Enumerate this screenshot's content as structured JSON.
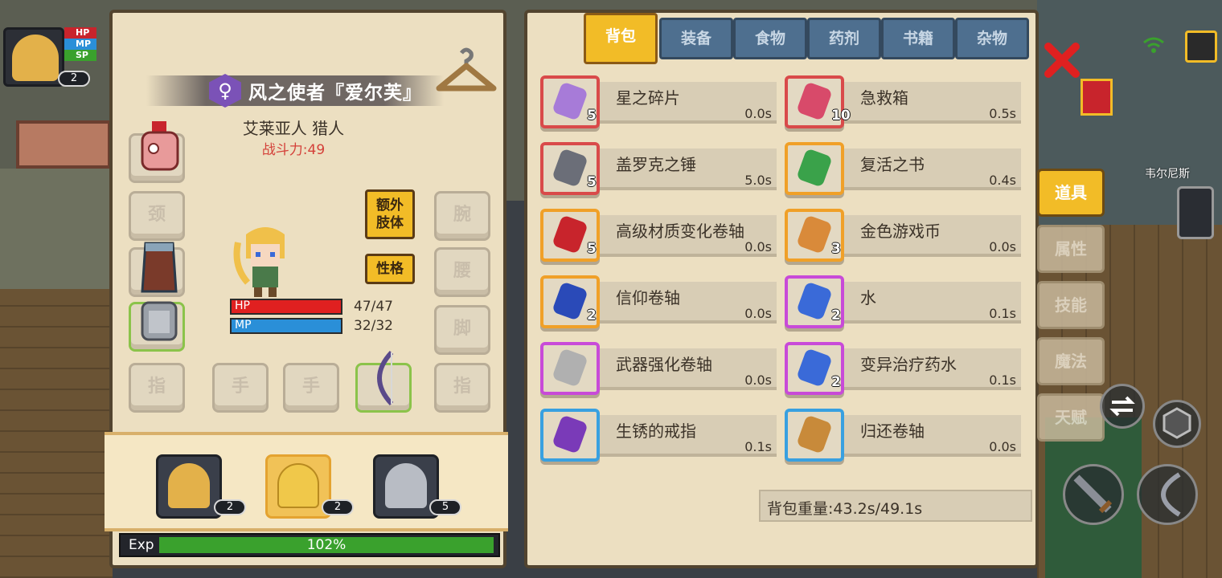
{
  "hud": {
    "stat_labels": [
      "HP",
      "MP",
      "SP"
    ],
    "portrait_level": "2",
    "npc_name": "韦尔尼斯"
  },
  "character": {
    "name": "风之使者『爱尔芙』",
    "gender_symbol": "♀",
    "race_class": "艾莱亚人 猎人",
    "power": "战斗力:49",
    "slots": {
      "neck": "颈",
      "wrist": "腕",
      "waist": "腰",
      "foot": "脚",
      "finger_left": "指",
      "hand_left": "手",
      "hand_right": "手",
      "finger_right": "指"
    },
    "extra_limb_button": "额外肢体",
    "personality_button": "性格",
    "hp_label": "HP",
    "hp_value": "47/47",
    "mp_label": "MP",
    "mp_value": "32/32",
    "hp_fraction": 1,
    "mp_fraction": 1
  },
  "party": [
    {
      "level": "2"
    },
    {
      "level": "2"
    },
    {
      "level": "5"
    }
  ],
  "exp": {
    "label": "Exp",
    "percent_text": "102%",
    "fill_fraction": 1
  },
  "inventory": {
    "tabs": [
      "背包",
      "装备",
      "食物",
      "药剂",
      "书籍",
      "杂物"
    ],
    "active_tab": "背包",
    "items": [
      {
        "name": "星之碎片",
        "qty": "5",
        "weight": "0.0s",
        "border": "#d94a4a",
        "icon_color": "#a77bd8"
      },
      {
        "name": "急救箱",
        "qty": "10",
        "weight": "0.5s",
        "border": "#d94a4a",
        "icon_color": "#d84a6a"
      },
      {
        "name": "盖罗克之锤",
        "qty": "5",
        "weight": "5.0s",
        "border": "#d94a4a",
        "icon_color": "#6b6e78"
      },
      {
        "name": "复活之书",
        "qty": "",
        "weight": "0.4s",
        "border": "#f0a028",
        "icon_color": "#3aa24a"
      },
      {
        "name": "高级材质变化卷轴",
        "qty": "5",
        "weight": "0.0s",
        "border": "#f0a028",
        "icon_color": "#c8242c"
      },
      {
        "name": "金色游戏币",
        "qty": "3",
        "weight": "0.0s",
        "border": "#f0a028",
        "icon_color": "#d98a3a"
      },
      {
        "name": "信仰卷轴",
        "qty": "2",
        "weight": "0.0s",
        "border": "#f0a028",
        "icon_color": "#2a4ab8"
      },
      {
        "name": "水",
        "qty": "2",
        "weight": "0.1s",
        "border": "#c84ad8",
        "icon_color": "#3a6ad8"
      },
      {
        "name": "武器强化卷轴",
        "qty": "",
        "weight": "0.0s",
        "border": "#c84ad8",
        "icon_color": "#b0b0b0"
      },
      {
        "name": "变异治疗药水",
        "qty": "2",
        "weight": "0.1s",
        "border": "#c84ad8",
        "icon_color": "#3a6ad8"
      },
      {
        "name": "生锈的戒指",
        "qty": "",
        "weight": "0.1s",
        "border": "#38a0e0",
        "icon_color": "#7a3ab8"
      },
      {
        "name": "归还卷轴",
        "qty": "",
        "weight": "0.0s",
        "border": "#38a0e0",
        "icon_color": "#c88a3a"
      }
    ],
    "weight_summary": "背包重量:43.2s/49.1s"
  },
  "side_menu": [
    "道具",
    "属性",
    "技能",
    "魔法",
    "天赋"
  ],
  "side_active": "道具",
  "colors": {
    "accent": "#f2bc27",
    "hp": "#e02020",
    "mp": "#2a8fd8",
    "exp": "#3aa12d"
  }
}
